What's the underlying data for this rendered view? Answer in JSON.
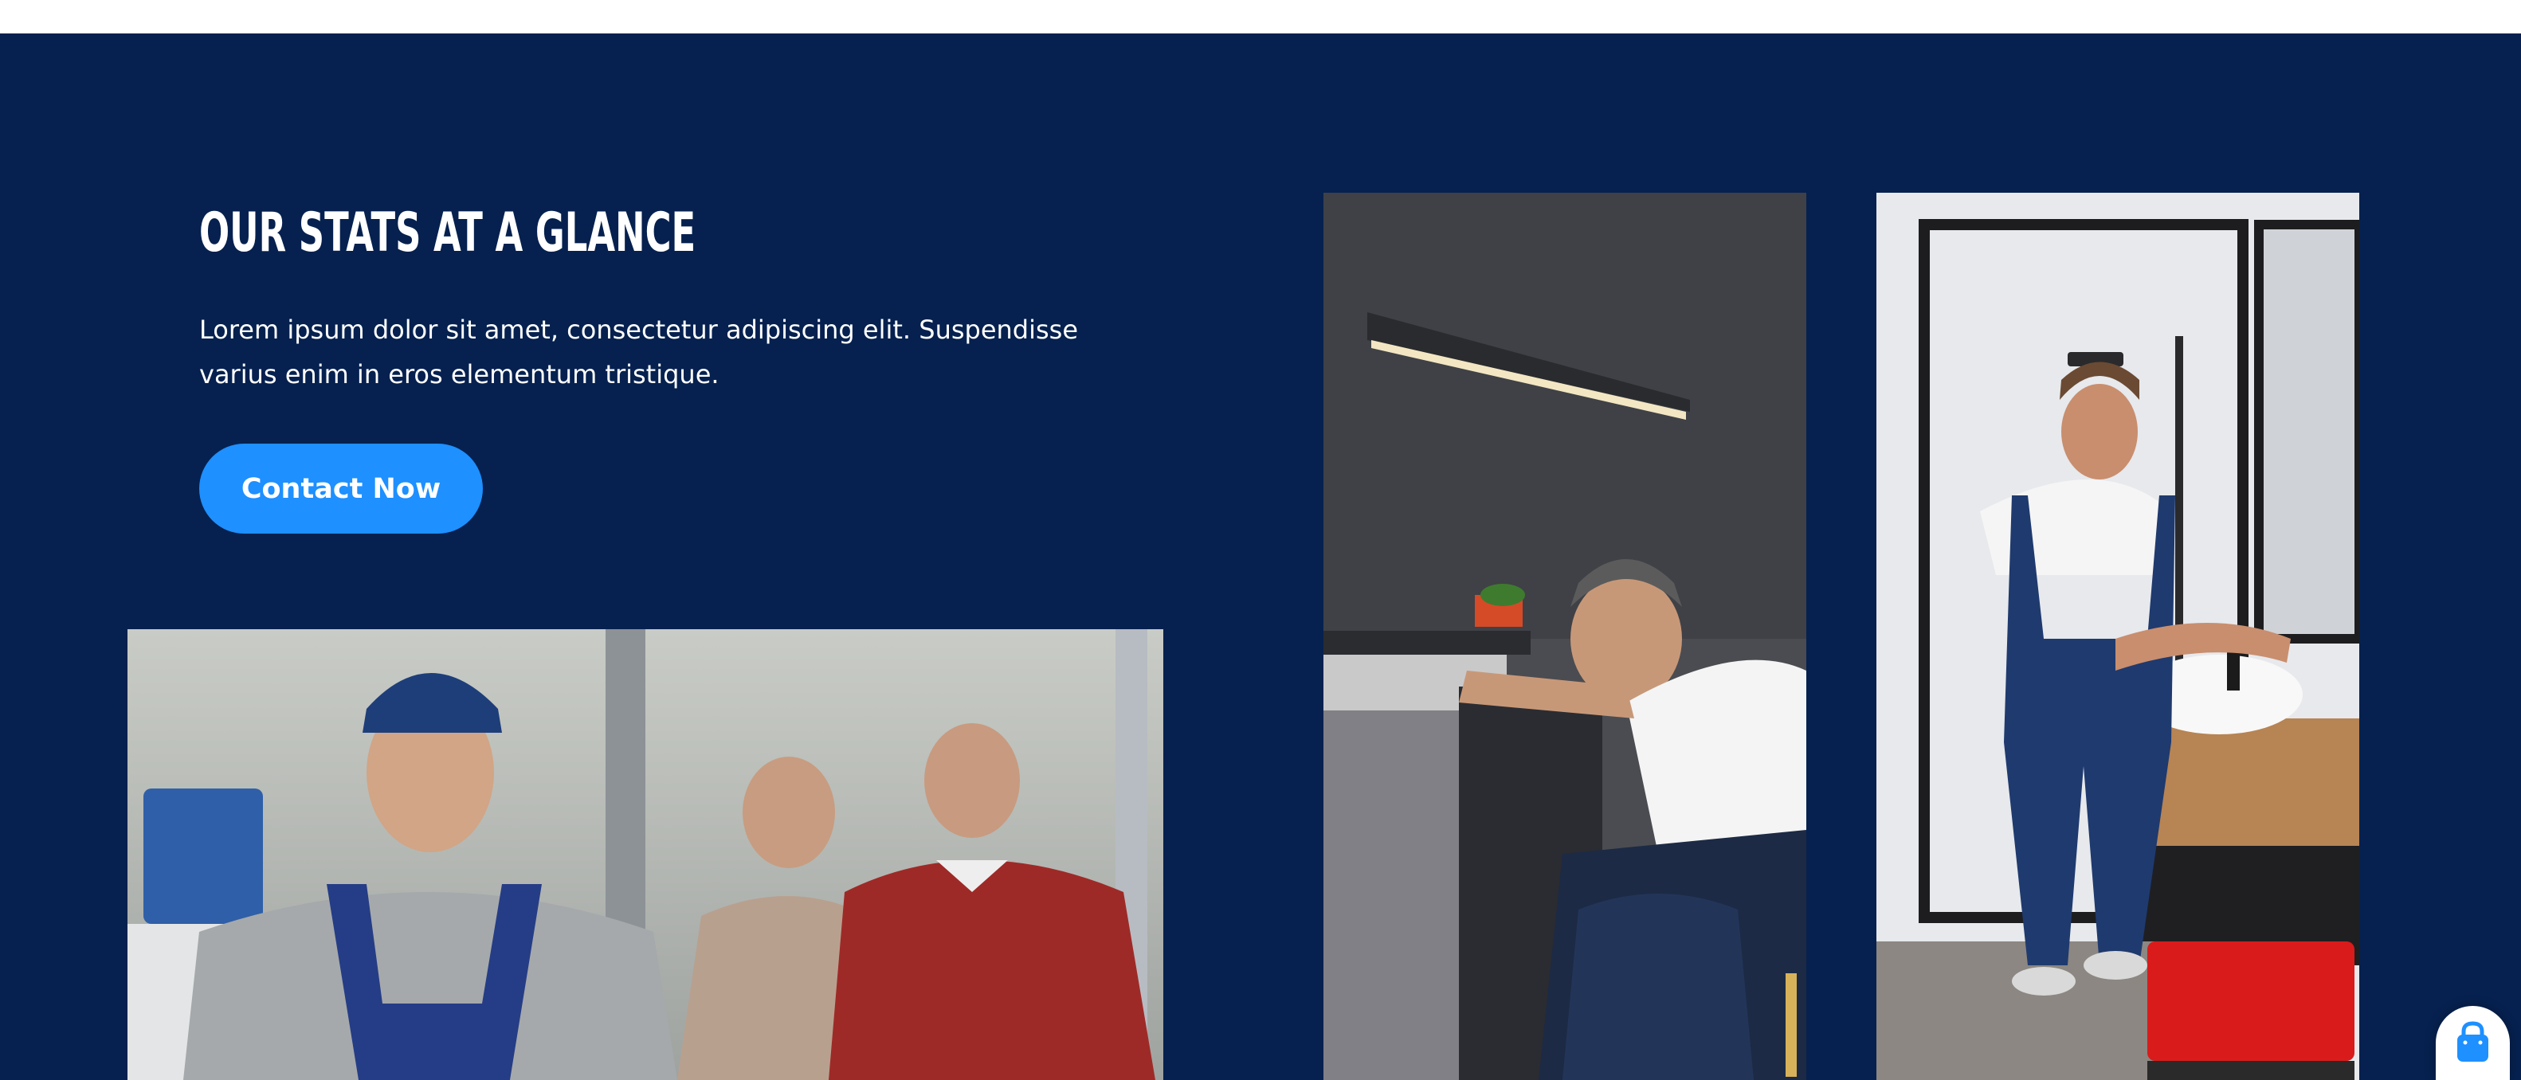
{
  "hero": {
    "title": "OUR STATS AT A GLANCE",
    "description": "Lorem ipsum dolor sit amet, consectetur adipiscing elit. Suspendisse varius enim in eros elementum tristique.",
    "cta_label": "Contact Now"
  },
  "images": [
    {
      "name": "mechanic-with-couple-photo"
    },
    {
      "name": "plumber-fixing-sink-photo"
    },
    {
      "name": "plumber-at-washbasin-photo"
    }
  ],
  "cart_button": {
    "icon": "shopping-bag-icon"
  },
  "colors": {
    "section_bg": "#06214f",
    "button_bg": "#1e90ff",
    "text": "#ffffff"
  }
}
